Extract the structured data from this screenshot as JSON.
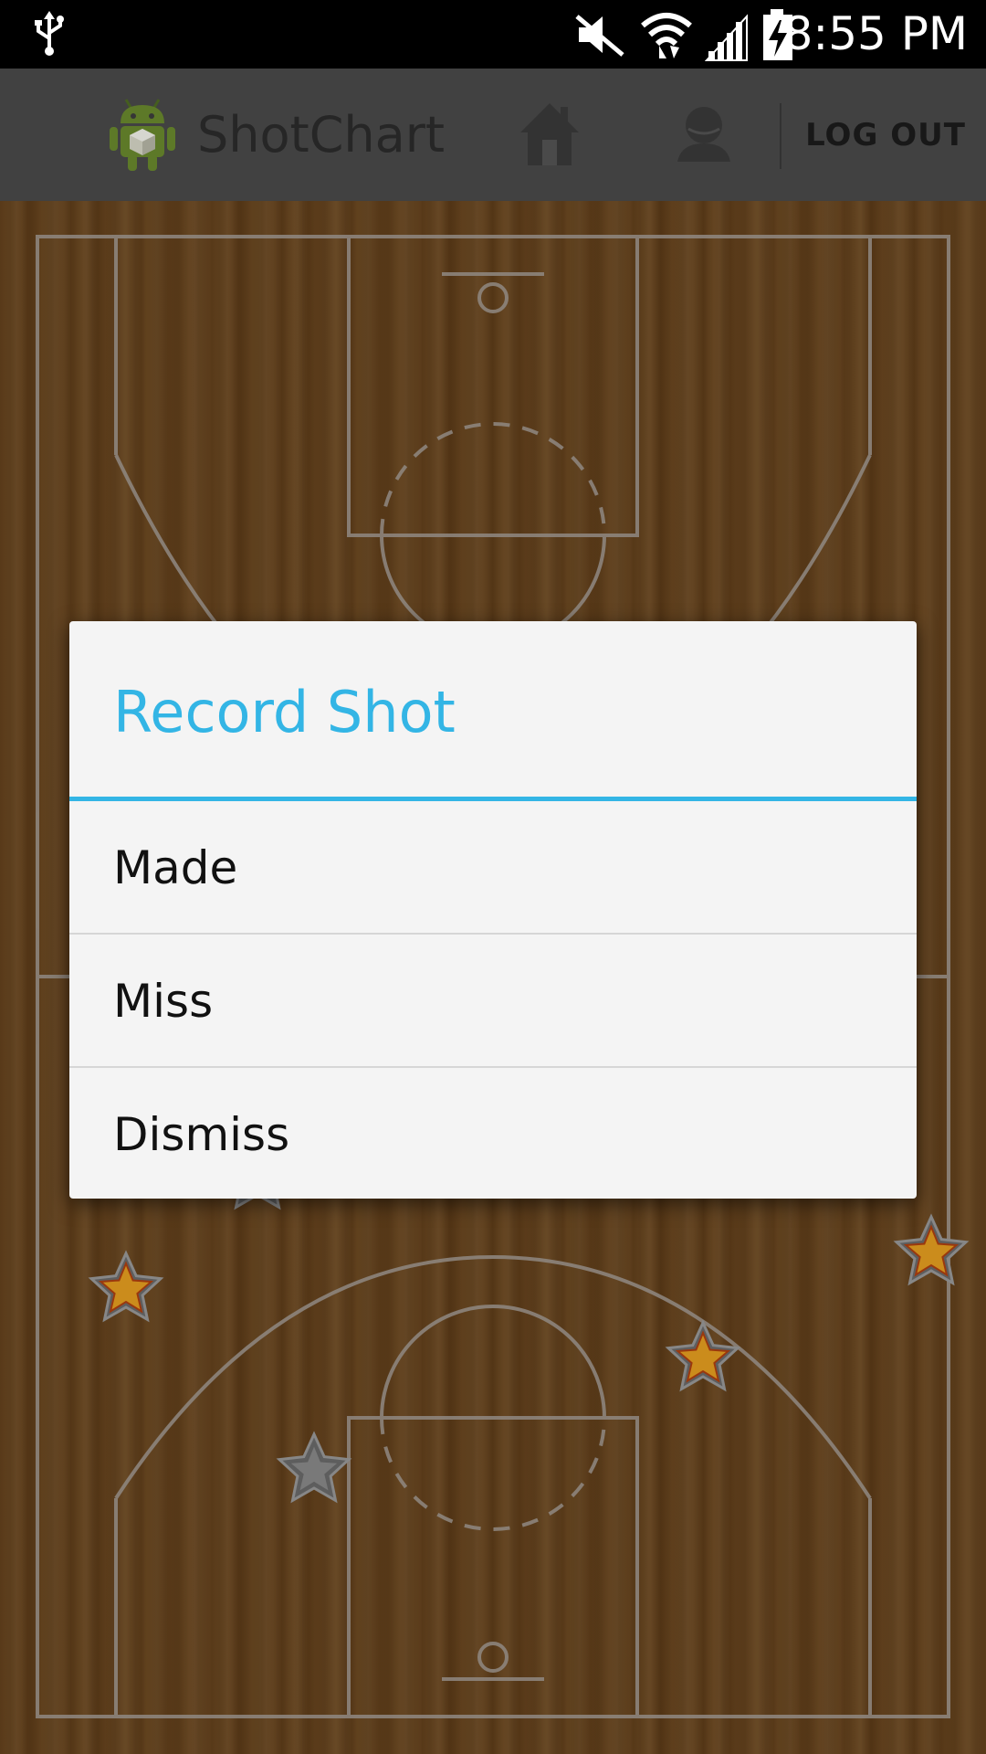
{
  "status_bar": {
    "time": "8:55 PM",
    "icons": [
      "usb-icon",
      "mute-icon",
      "wifi-icon",
      "signal-icon",
      "battery-charging-icon"
    ]
  },
  "action_bar": {
    "app_title": "ShotChart",
    "app_icon": "android-icon",
    "home_icon": "home-icon",
    "profile_icon": "user-icon",
    "logout_label": "LOG OUT"
  },
  "dialog": {
    "title": "Record Shot",
    "options": [
      "Made",
      "Miss",
      "Dismiss"
    ]
  },
  "colors": {
    "accent": "#33b5e5",
    "court_wood": "#6e4a22",
    "court_lines": "#a49c94",
    "made_star": "#e8a020",
    "missed_star": "#8a8a8a"
  },
  "shots": [
    {
      "result": "made"
    },
    {
      "result": "made"
    },
    {
      "result": "missed"
    },
    {
      "result": "made"
    },
    {
      "result": "made"
    },
    {
      "result": "made"
    },
    {
      "result": "missed"
    }
  ]
}
